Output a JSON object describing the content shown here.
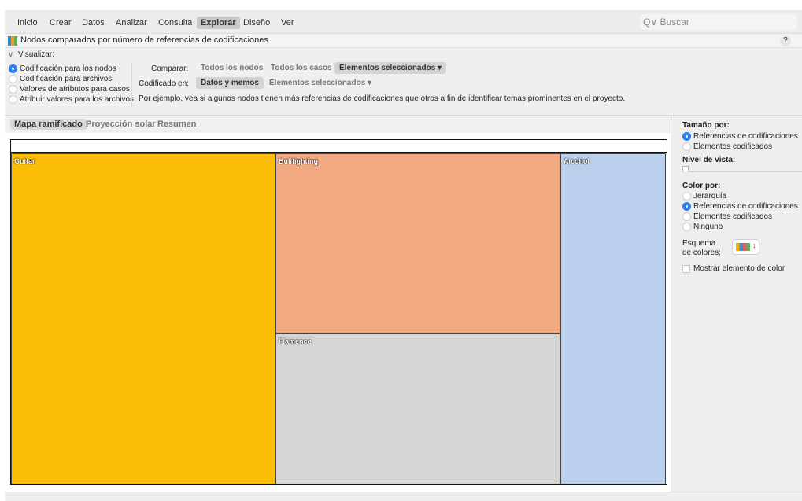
{
  "menu": {
    "items": [
      "Inicio",
      "Crear",
      "Datos",
      "Analizar",
      "Consulta",
      "Explorar",
      "Diseño",
      "Ver"
    ],
    "active": "Explorar",
    "search_placeholder": "Buscar"
  },
  "window": {
    "title": "Nodos comparados por número de referencias de codificaciones",
    "help": "?"
  },
  "options": {
    "visualize_label": "Visualizar:",
    "visualize_options": [
      {
        "label": "Codificación para los nodos",
        "selected": true
      },
      {
        "label": "Codificación para archivos",
        "selected": false
      },
      {
        "label": "Valores de atributos para casos",
        "selected": false
      },
      {
        "label": "Atribuir valores para los archivos",
        "selected": false
      }
    ],
    "compare_label": "Comparar:",
    "compare_options": [
      "Todos los nodos",
      "Todos los casos",
      "Elementos seleccionados ▾"
    ],
    "compare_selected": "Elementos seleccionados ▾",
    "coded_in_label": "Codificado en:",
    "coded_in_options": [
      "Datos y memos",
      "Elementos seleccionados ▾"
    ],
    "coded_in_selected": "Datos y memos",
    "example_text": "Por ejemplo, vea si algunos nodos tienen más referencias de codificaciones que otros a fin de identificar temas prominentes en el proyecto."
  },
  "tabs": {
    "items": [
      "Mapa ramificado",
      "Proyección solar",
      "Resumen"
    ],
    "selected": "Mapa ramificado"
  },
  "treemap": {
    "cells": [
      {
        "label": "Guitar",
        "color": "#fbbd08"
      },
      {
        "label": "Bullfighting",
        "color": "#f2a880"
      },
      {
        "label": "Flamenco",
        "color": "#d6d6d6"
      },
      {
        "label": "Alcohol",
        "color": "#bad0ec"
      }
    ]
  },
  "right_panel": {
    "size_by_label": "Tamaño por:",
    "size_by_options": [
      {
        "label": "Referencias de codificaciones",
        "selected": true
      },
      {
        "label": "Elementos codificados",
        "selected": false
      }
    ],
    "view_level_label": "Nivel de vista:",
    "color_by_label": "Color por:",
    "color_by_options": [
      {
        "label": "Jerarquía",
        "selected": false
      },
      {
        "label": "Referencias de codificaciones",
        "selected": true
      },
      {
        "label": "Elementos codificados",
        "selected": false
      },
      {
        "label": "Ninguno",
        "selected": false
      }
    ],
    "scheme_label_1": "Esquema",
    "scheme_label_2": "de colores:",
    "show_color_item_label": "Mostrar elemento de color",
    "show_color_item_checked": false
  }
}
